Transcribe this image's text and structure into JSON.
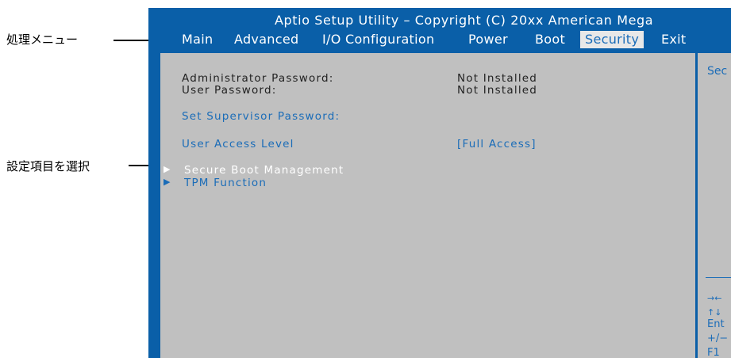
{
  "annotations": {
    "menu_label": "処理メニュー",
    "select_label": "設定項目を選択"
  },
  "title": "Aptio Setup Utility – Copyright (C) 20xx American Mega",
  "menu": [
    "Main",
    "Advanced",
    "I/O Configuration",
    "Power",
    "Boot",
    "Security",
    "Exit"
  ],
  "active_menu": "Security",
  "security": {
    "admin_label": "Administrator Password:",
    "admin_value": "Not Installed",
    "user_label": "User Password:",
    "user_value": "Not Installed",
    "set_supervisor": "Set Supervisor Password:",
    "access_label": "User Access Level",
    "access_value": "[Full Access]",
    "secure_boot": "Secure Boot Management",
    "tpm": "TPM Function"
  },
  "help": {
    "title": "Sec",
    "keys": [
      "→←",
      "↑↓",
      "Ent",
      "+/−",
      "F1"
    ]
  },
  "colors": {
    "bios_blue": "#0a5fa8",
    "panel_gray": "#c0c0c0",
    "highlight_text": "#1a6cb8"
  }
}
